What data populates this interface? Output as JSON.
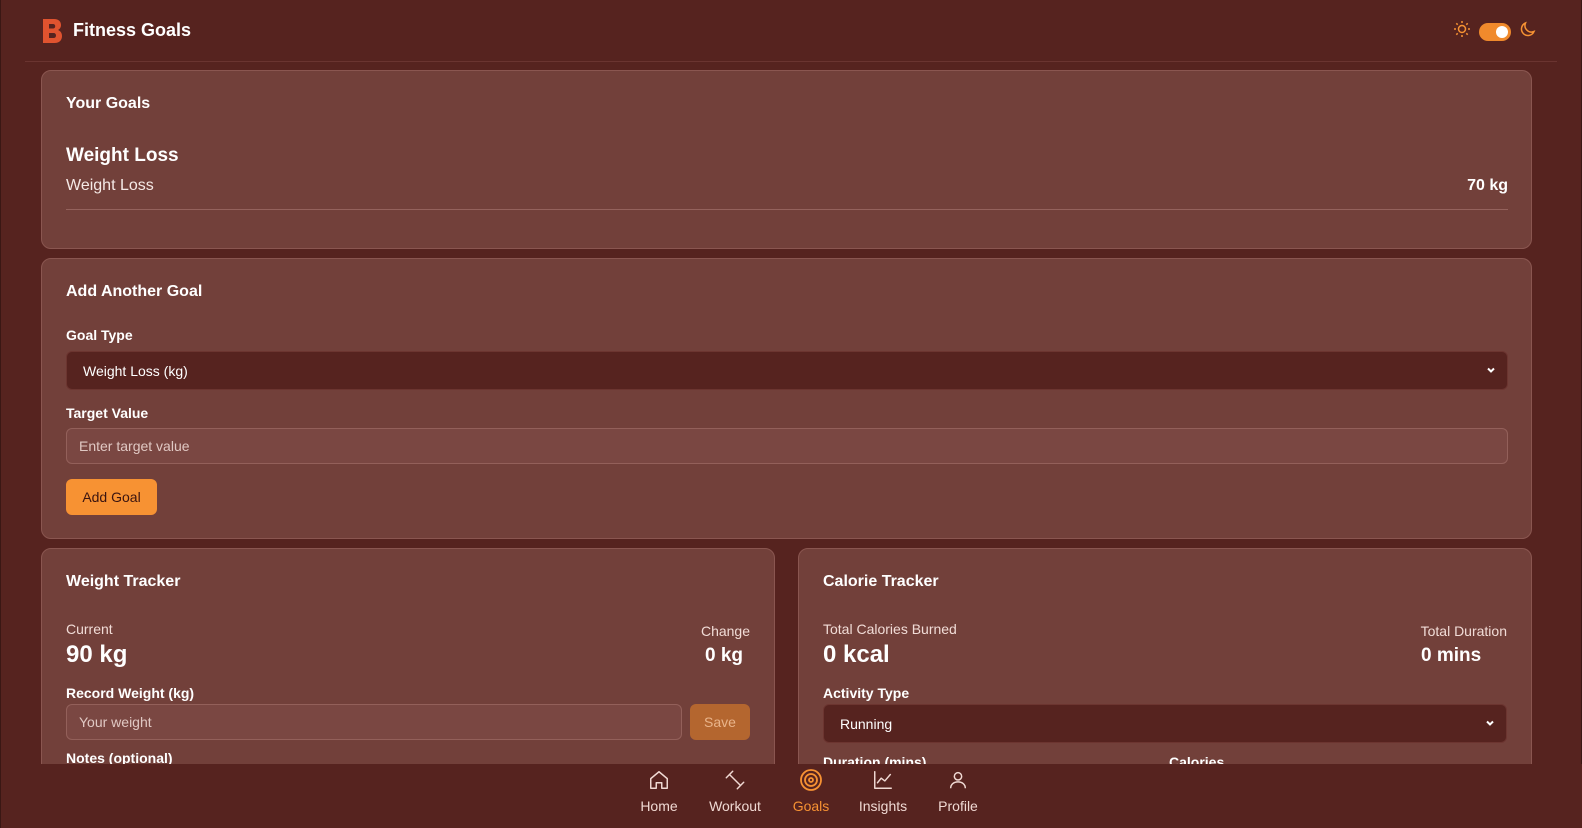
{
  "header": {
    "title": "Fitness Goals",
    "logo_letter": "B",
    "theme_toggle_state": "dark"
  },
  "goals": {
    "title": "Your Goals",
    "heading": "Weight Loss",
    "items": [
      {
        "name": "Weight Loss",
        "value": "70 kg"
      }
    ]
  },
  "add_goal": {
    "title": "Add Another Goal",
    "goal_type_label": "Goal Type",
    "goal_type_value": "Weight Loss (kg)",
    "target_label": "Target Value",
    "target_placeholder": "Enter target value",
    "button_label": "Add Goal"
  },
  "weight_tracker": {
    "title": "Weight Tracker",
    "current_label": "Current",
    "current_value": "90 kg",
    "change_label": "Change",
    "change_value": "0 kg",
    "record_label": "Record Weight (kg)",
    "record_placeholder": "Your weight",
    "save_label": "Save",
    "notes_label": "Notes (optional)"
  },
  "calorie_tracker": {
    "title": "Calorie Tracker",
    "calories_label": "Total Calories Burned",
    "calories_value": "0 kcal",
    "duration_label": "Total Duration",
    "duration_value": "0 mins",
    "activity_label": "Activity Type",
    "activity_value": "Running",
    "duration_field_label": "Duration (mins)",
    "calories_field_label": "Calories"
  },
  "nav": {
    "items": [
      {
        "label": "Home",
        "icon": "home-icon"
      },
      {
        "label": "Workout",
        "icon": "dumbbell-icon"
      },
      {
        "label": "Goals",
        "icon": "target-icon",
        "active": true
      },
      {
        "label": "Insights",
        "icon": "chart-line-icon"
      },
      {
        "label": "Profile",
        "icon": "user-icon"
      }
    ]
  },
  "colors": {
    "background": "#56231f",
    "card": "#72403a",
    "accent": "#f79233",
    "brand": "#e0532f"
  }
}
